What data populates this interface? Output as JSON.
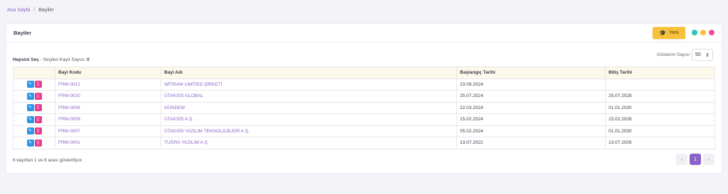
{
  "breadcrumb": {
    "home": "Ana Sayfa",
    "sep": "/",
    "current": "Bayiler"
  },
  "card": {
    "title": "Bayiler",
    "new_label": "Yeni",
    "dots": [
      "#2ec4b6",
      "#f8c13a",
      "#f04e98"
    ]
  },
  "selection": {
    "select_all": "Hepsini Seç",
    "count_label": " - Seçilen Kayıt Sayısı: ",
    "count": "0"
  },
  "page_size": {
    "label": "Gösterim Sayısı",
    "value": "50"
  },
  "table": {
    "headers": [
      "",
      "Bayi Kodu",
      "Bayi Adı",
      "Başlangıç Tarihi",
      "Bitiş Tarihi"
    ],
    "rows": [
      {
        "code": "FRM-0012",
        "name": "WİTRAW LİMİTED ŞİRKETİ",
        "start": "23.09.2024",
        "end": ""
      },
      {
        "code": "FRM-0010",
        "name": "ÜTAKSİS GLOBAL",
        "start": "25.07.2024",
        "end": "25.07.2028"
      },
      {
        "code": "FRM-0006",
        "name": "GÜNDEM",
        "start": "22.03.2024",
        "end": "01.01.2030"
      },
      {
        "code": "FRM-0009",
        "name": "ÜTAKSİS A.Ş.",
        "start": "15.02.2024",
        "end": "15.02.2026"
      },
      {
        "code": "FRM-0007",
        "name": "ÜTAKSİS YAZILIM TEKNOLOJİLERİ A.Ş.",
        "start": "05.02.2024",
        "end": "01.01.2030"
      },
      {
        "code": "FRM-0001",
        "name": "TUĞRA YAZILIM A.Ş",
        "start": "13.07.2022",
        "end": "13.07.2026"
      }
    ]
  },
  "footer": {
    "info": "6 kayıttan 1 ve 6 arası gösteriliyor."
  },
  "pager": {
    "prev": "‹",
    "page": "1",
    "next": "›"
  }
}
